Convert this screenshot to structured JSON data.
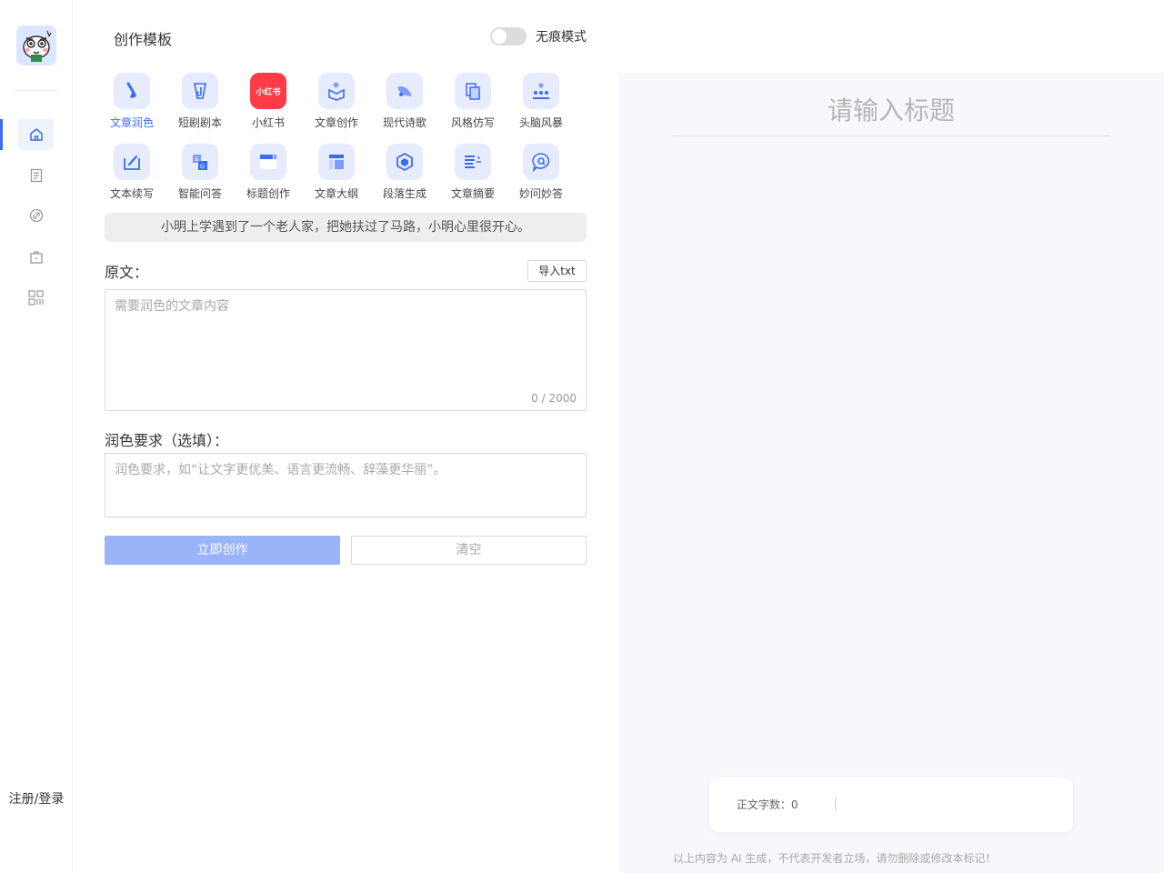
{
  "sidebar": {
    "logo_icon": "mascot-logo-icon",
    "nav": [
      {
        "icon": "home-icon",
        "active": true
      },
      {
        "icon": "document-list-icon",
        "active": false
      },
      {
        "icon": "link-circle-icon",
        "active": false
      },
      {
        "icon": "briefcase-icon",
        "active": false
      },
      {
        "icon": "apps-grid-icon",
        "active": false
      }
    ],
    "login_label": "注册/登录"
  },
  "panel": {
    "title": "创作模板",
    "incognito_label": "无痕模式",
    "incognito_on": false
  },
  "templates": [
    {
      "label": "文章润色",
      "icon": "brush-icon",
      "active": true
    },
    {
      "label": "短剧剧本",
      "icon": "music-pen-icon"
    },
    {
      "label": "小红书",
      "icon": "xiaohongshu-logo-icon",
      "badge": "小红书"
    },
    {
      "label": "文章创作",
      "icon": "open-box-icon"
    },
    {
      "label": "现代诗歌",
      "icon": "fan-icon"
    },
    {
      "label": "风格仿写",
      "icon": "copy-document-icon"
    },
    {
      "label": "头脑风暴",
      "icon": "people-group-icon"
    },
    {
      "label": "文本续写",
      "icon": "edit-box-icon"
    },
    {
      "label": "智能问答",
      "icon": "qa-cards-icon"
    },
    {
      "label": "标题创作",
      "icon": "title-window-icon"
    },
    {
      "label": "文章大纲",
      "icon": "outline-layout-icon"
    },
    {
      "label": "段落生成",
      "icon": "hexagon-icon"
    },
    {
      "label": "文章摘要",
      "icon": "summary-lines-icon"
    },
    {
      "label": "妙问妙答",
      "icon": "chat-bubble-q-icon"
    }
  ],
  "example_text": "小明上学遇到了一个老人家，把她扶过了马路，小明心里很开心。",
  "original": {
    "label": "原文：",
    "import_label": "导入txt",
    "placeholder": "需要润色的文章内容",
    "counter": "0 / 2000"
  },
  "requirement": {
    "label": "润色要求（选填）：",
    "placeholder": "润色要求，如“让文字更优美、语言更流畅、辞藻更华丽”。"
  },
  "actions": {
    "create_label": "立即创作",
    "clear_label": "清空"
  },
  "editor": {
    "title_placeholder": "请输入标题",
    "word_count": "正文字数：0",
    "disclaimer": "以上内容为 AI 生成，不代表开发者立场，请勿删除或修改本标记！"
  },
  "colors": {
    "accent": "#3a6cf4",
    "icon_bg": "#e6ecfd",
    "create_button": "#9ab4fa",
    "editor_bg": "#f7f8fb"
  }
}
